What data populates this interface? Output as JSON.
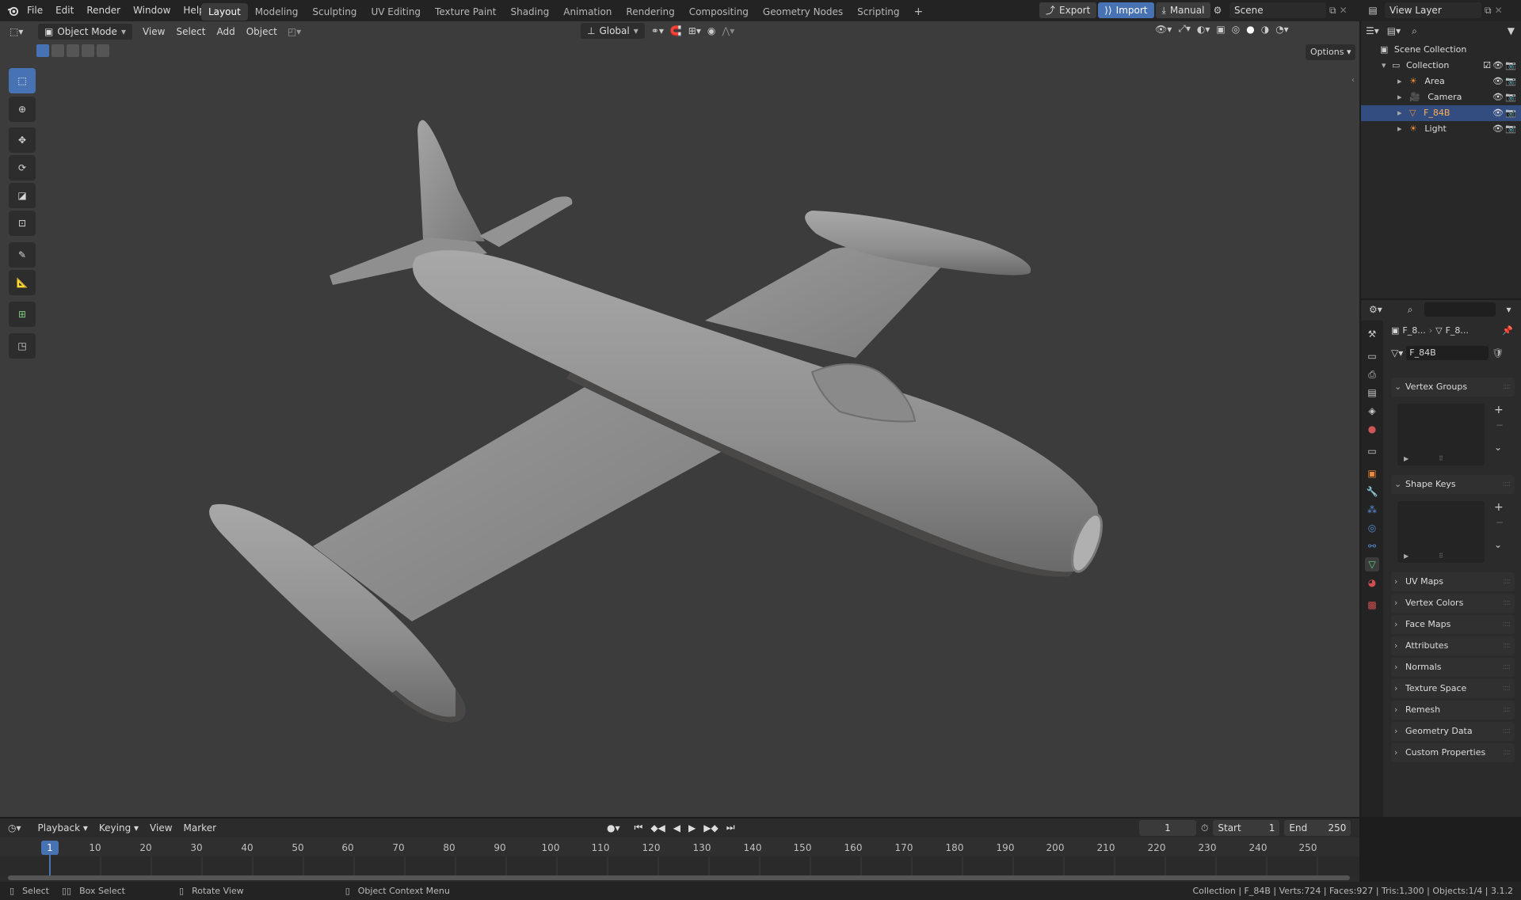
{
  "topbar": {
    "menus": [
      "File",
      "Edit",
      "Render",
      "Window",
      "Help"
    ],
    "workspaces": [
      "Layout",
      "Modeling",
      "Sculpting",
      "UV Editing",
      "Texture Paint",
      "Shading",
      "Animation",
      "Rendering",
      "Compositing",
      "Geometry Nodes",
      "Scripting"
    ],
    "active_workspace": "Layout",
    "add_tab": "+",
    "export_label": "Export",
    "import_label": "Import",
    "manual_label": "Manual",
    "scene": "Scene",
    "view_layer": "View Layer"
  },
  "viewport_header": {
    "mode": "Object Mode",
    "menus": [
      "View",
      "Select",
      "Add",
      "Object"
    ],
    "orientation": "Global",
    "options": "Options"
  },
  "outliner": {
    "scene_collection": "Scene Collection",
    "collection": "Collection",
    "items": [
      {
        "name": "Area",
        "selected": false
      },
      {
        "name": "Camera",
        "selected": false
      },
      {
        "name": "F_84B",
        "selected": true
      },
      {
        "name": "Light",
        "selected": false
      }
    ]
  },
  "properties": {
    "breadcrumb_object": "F_8...",
    "breadcrumb_mesh": "F_8...",
    "mesh_name": "F_84B",
    "panels": {
      "vertex_groups": "Vertex Groups",
      "shape_keys": "Shape Keys",
      "collapsed": [
        "UV Maps",
        "Vertex Colors",
        "Face Maps",
        "Attributes",
        "Normals",
        "Texture Space",
        "Remesh",
        "Geometry Data",
        "Custom Properties"
      ]
    }
  },
  "timeline": {
    "menus": [
      "Playback",
      "Keying",
      "View",
      "Marker"
    ],
    "current_frame": "1",
    "start_label": "Start",
    "start": "1",
    "end_label": "End",
    "end": "250",
    "ruler": [
      "1",
      "10",
      "20",
      "30",
      "40",
      "50",
      "60",
      "70",
      "80",
      "90",
      "100",
      "110",
      "120",
      "130",
      "140",
      "150",
      "160",
      "170",
      "180",
      "190",
      "200",
      "210",
      "220",
      "230",
      "240",
      "250"
    ]
  },
  "statusbar": {
    "select": "Select",
    "box_select": "Box Select",
    "rotate_view": "Rotate View",
    "context_menu": "Object Context Menu",
    "stats": "Collection | F_84B | Verts:724 | Faces:927 | Tris:1,300 | Objects:1/4 | 3.1.2"
  },
  "colors": {
    "accent": "#4772b3",
    "selected_row": "#334d80",
    "viewport": "#3c3c3c",
    "object_orange": "#e88a3a"
  }
}
